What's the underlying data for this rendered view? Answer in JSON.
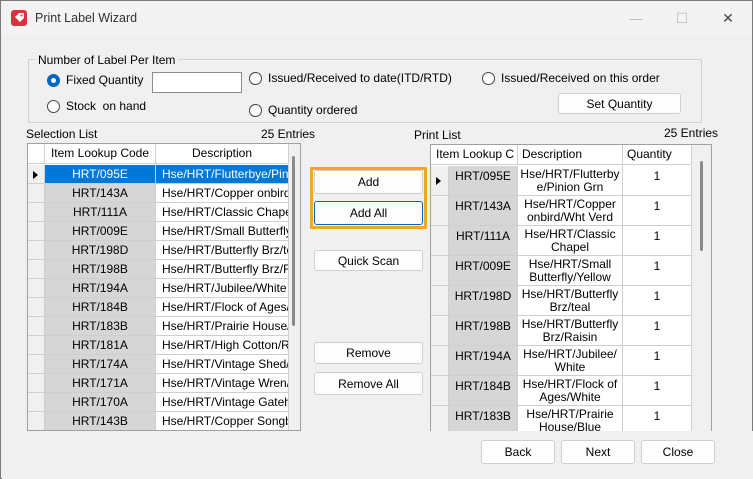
{
  "window": {
    "title": "Print Label Wizard",
    "controls": {
      "minimize": "—",
      "maximize": "☐",
      "close": "✕"
    }
  },
  "group": {
    "legend": "Number of Label Per Item",
    "fixed_quantity": "Fixed Quantity",
    "fixed_quantity_value": "",
    "stock_on_hand": "Stock  on hand",
    "issued_received_itd": "Issued/Received to date(ITD/RTD)",
    "quantity_ordered": "Quantity ordered",
    "issued_received_order": "Issued/Received on this order",
    "set_quantity": "Set Quantity"
  },
  "selection": {
    "label": "Selection List",
    "entries": "25 Entries",
    "columns": [
      "Item Lookup Code",
      "Description"
    ],
    "rows": [
      {
        "code": "HRT/095E",
        "desc": "Hse/HRT/Flutterbye/Pini"
      },
      {
        "code": "HRT/143A",
        "desc": "Hse/HRT/Copper onbird/"
      },
      {
        "code": "HRT/111A",
        "desc": "Hse/HRT/Classic Chape"
      },
      {
        "code": "HRT/009E",
        "desc": "Hse/HRT/Small Butterfly"
      },
      {
        "code": "HRT/198D",
        "desc": "Hse/HRT/Butterfly Brz/te"
      },
      {
        "code": "HRT/198B",
        "desc": "Hse/HRT/Butterfly Brz/R"
      },
      {
        "code": "HRT/194A",
        "desc": "Hse/HRT/Jubilee/White"
      },
      {
        "code": "HRT/184B",
        "desc": "Hse/HRT/Flock of Ages/"
      },
      {
        "code": "HRT/183B",
        "desc": "Hse/HRT/Prairie House/"
      },
      {
        "code": "HRT/181A",
        "desc": "Hse/HRT/High Cotton/R"
      },
      {
        "code": "HRT/174A",
        "desc": "Hse/HRT/Vintage Shed/"
      },
      {
        "code": "HRT/171A",
        "desc": "Hse/HRT/Vintage Wren/"
      },
      {
        "code": "HRT/170A",
        "desc": "Hse/HRT/Vintage Gateh"
      },
      {
        "code": "HRT/143B",
        "desc": "Hse/HRT/Copper Songbi"
      }
    ]
  },
  "actions": {
    "add": "Add",
    "add_all": "Add All",
    "quick_scan": "Quick Scan",
    "remove": "Remove",
    "remove_all": "Remove All"
  },
  "print": {
    "label": "Print List",
    "entries": "25 Entries",
    "columns": [
      "Item Lookup C",
      "Description",
      "Quantity"
    ],
    "rows": [
      {
        "code": "HRT/095E",
        "desc1": "Hse/HRT/Flutterby",
        "desc2": "e/Pinion Grn",
        "qty": "1"
      },
      {
        "code": "HRT/143A",
        "desc1": "Hse/HRT/Copper",
        "desc2": "onbird/Wht Verd",
        "qty": "1"
      },
      {
        "code": "HRT/111A",
        "desc1": "Hse/HRT/Classic",
        "desc2": "Chapel",
        "qty": "1"
      },
      {
        "code": "HRT/009E",
        "desc1": "Hse/HRT/Small",
        "desc2": "Butterfly/Yellow",
        "qty": "1"
      },
      {
        "code": "HRT/198D",
        "desc1": "Hse/HRT/Butterfly",
        "desc2": "Brz/teal",
        "qty": "1"
      },
      {
        "code": "HRT/198B",
        "desc1": "Hse/HRT/Butterfly",
        "desc2": "Brz/Raisin",
        "qty": "1"
      },
      {
        "code": "HRT/194A",
        "desc1": "Hse/HRT/Jubilee/",
        "desc2": "White",
        "qty": "1"
      },
      {
        "code": "HRT/184B",
        "desc1": "Hse/HRT/Flock of",
        "desc2": "Ages/White",
        "qty": "1"
      },
      {
        "code": "HRT/183B",
        "desc1": "Hse/HRT/Prairie",
        "desc2": "House/Blue",
        "qty": "1"
      }
    ]
  },
  "footer": {
    "back": "Back",
    "next": "Next",
    "close": "Close"
  },
  "colors": {
    "accent": "#0067c0",
    "highlight": "#f5a623",
    "selected_row": "#0078d7",
    "app_icon": "#d9333f"
  }
}
